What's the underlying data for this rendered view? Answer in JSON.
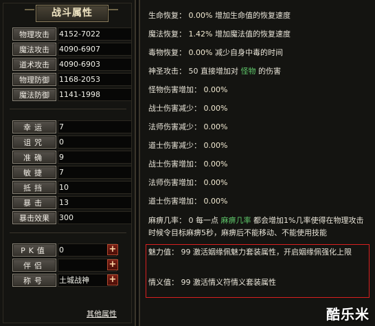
{
  "left": {
    "title": "战斗属性",
    "stats": [
      {
        "label": "物理攻击",
        "value": "4152-7022"
      },
      {
        "label": "魔法攻击",
        "value": "4090-6907"
      },
      {
        "label": "道术攻击",
        "value": "4090-6903"
      },
      {
        "label": "物理防御",
        "value": "1168-2053"
      },
      {
        "label": "魔法防御",
        "value": "1141-1998"
      }
    ],
    "attrs": [
      {
        "label": "幸运",
        "value": "7"
      },
      {
        "label": "诅咒",
        "value": "0"
      },
      {
        "label": "准确",
        "value": "9"
      },
      {
        "label": "敏捷",
        "value": "7"
      },
      {
        "label": "抵挡",
        "value": "10"
      },
      {
        "label": "暴击",
        "value": "13"
      },
      {
        "label": "暴击效果",
        "value": "300"
      }
    ],
    "social": [
      {
        "label": "PK值",
        "value": "0",
        "plus": "+"
      },
      {
        "label": "伴侣",
        "value": "",
        "plus": "+"
      },
      {
        "label": "称号",
        "value": "土城战神",
        "plus": "+"
      }
    ],
    "other_link": "其他属性"
  },
  "right": {
    "lines": [
      {
        "label": "生命恢复：",
        "value": "0.00%",
        "desc": "增加生命值的恢复速度"
      },
      {
        "label": "魔法恢复：",
        "value": "1.42%",
        "desc": "增加魔法值的恢复速度"
      },
      {
        "label": "毒物恢复：",
        "value": "0.00%",
        "desc": "减少自身中毒的时间"
      }
    ],
    "holy": {
      "label": "神圣攻击：",
      "pre": "50 直接增加对",
      "target": "怪物",
      "post": "的伤害"
    },
    "damage": [
      {
        "label": "怪物伤害增加：",
        "value": "0.00%"
      },
      {
        "label": "战士伤害减少：",
        "value": "0.00%"
      },
      {
        "label": "法师伤害减少：",
        "value": "0.00%"
      },
      {
        "label": "道士伤害减少：",
        "value": "0.00%"
      },
      {
        "label": "战士伤害增加：",
        "value": "0.00%"
      },
      {
        "label": "法师伤害增加：",
        "value": "0.00%"
      },
      {
        "label": "道士伤害增加：",
        "value": "0.00%"
      }
    ],
    "paralysis": {
      "label": "麻痹几率：",
      "pre": "0  每一点",
      "key": "麻痹几率",
      "post": "都会增加1%几率使得在物理攻击时候令目标麻痹5秒，麻痹后不能移动、不能使用技能"
    },
    "charm": {
      "label": "魅力值：",
      "value": "99",
      "desc": "激活姻缘佩魅力套装属性，开启姻缘佩强化上限"
    },
    "loyalty": {
      "label": "情义值：",
      "value": "99",
      "desc": "激活情义符情义套装属性"
    }
  },
  "watermark": "酷乐米"
}
